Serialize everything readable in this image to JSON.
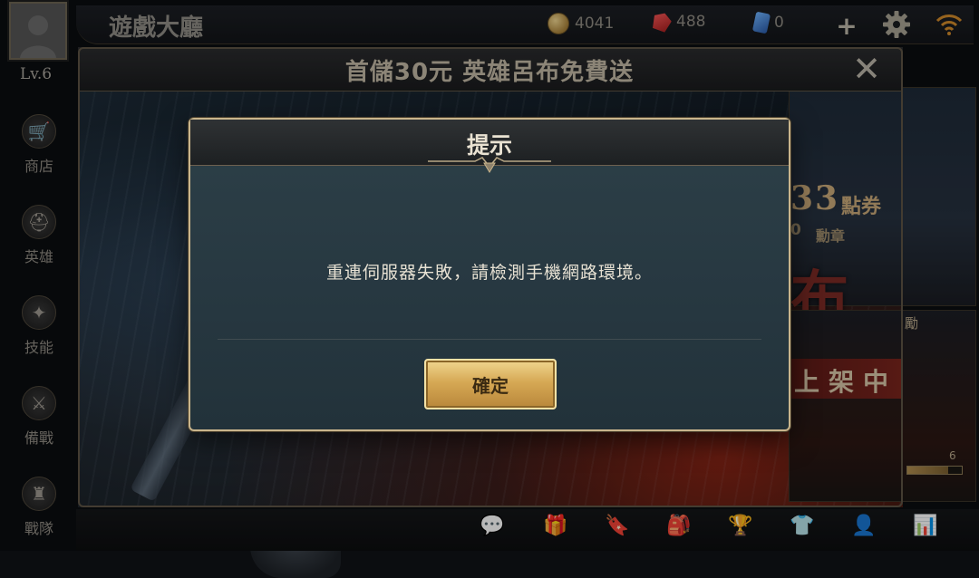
{
  "header": {
    "title": "遊戲大廳",
    "coins": "4041",
    "gems": "488",
    "cards": "0"
  },
  "player": {
    "level": "Lv.6"
  },
  "sidebar": {
    "items": [
      {
        "label": "商店",
        "icon": "shop-cart-icon"
      },
      {
        "label": "英雄",
        "icon": "hero-helmet-icon"
      },
      {
        "label": "技能",
        "icon": "skill-flame-icon"
      },
      {
        "label": "備戰",
        "icon": "prepare-sword-icon"
      },
      {
        "label": "戰隊",
        "icon": "team-emblem-icon"
      }
    ]
  },
  "promo": {
    "title": "首儲30元 英雄呂布免費送",
    "points": "33",
    "points_unit": "點券",
    "sub_number": "0",
    "sub_unit": "勳章",
    "hero_name": "布",
    "reward_label": "勵",
    "on_sale": "上架中",
    "progress_max": "6",
    "progress_fraction": 0.75
  },
  "alert": {
    "title": "提示",
    "message": "重連伺服器失敗，請檢測手機網路環境。",
    "confirm_label": "確定"
  },
  "bottom_bar": {
    "icons": [
      "chat-icon",
      "gift-icon",
      "bookmark-icon",
      "backpack-icon",
      "trophy-icon",
      "shirt-icon",
      "friends-icon",
      "ranking-icon"
    ]
  },
  "colors": {
    "gold_button": "#d6a955",
    "dialog_border": "#c9b58c",
    "dialog_body": "#273841"
  }
}
